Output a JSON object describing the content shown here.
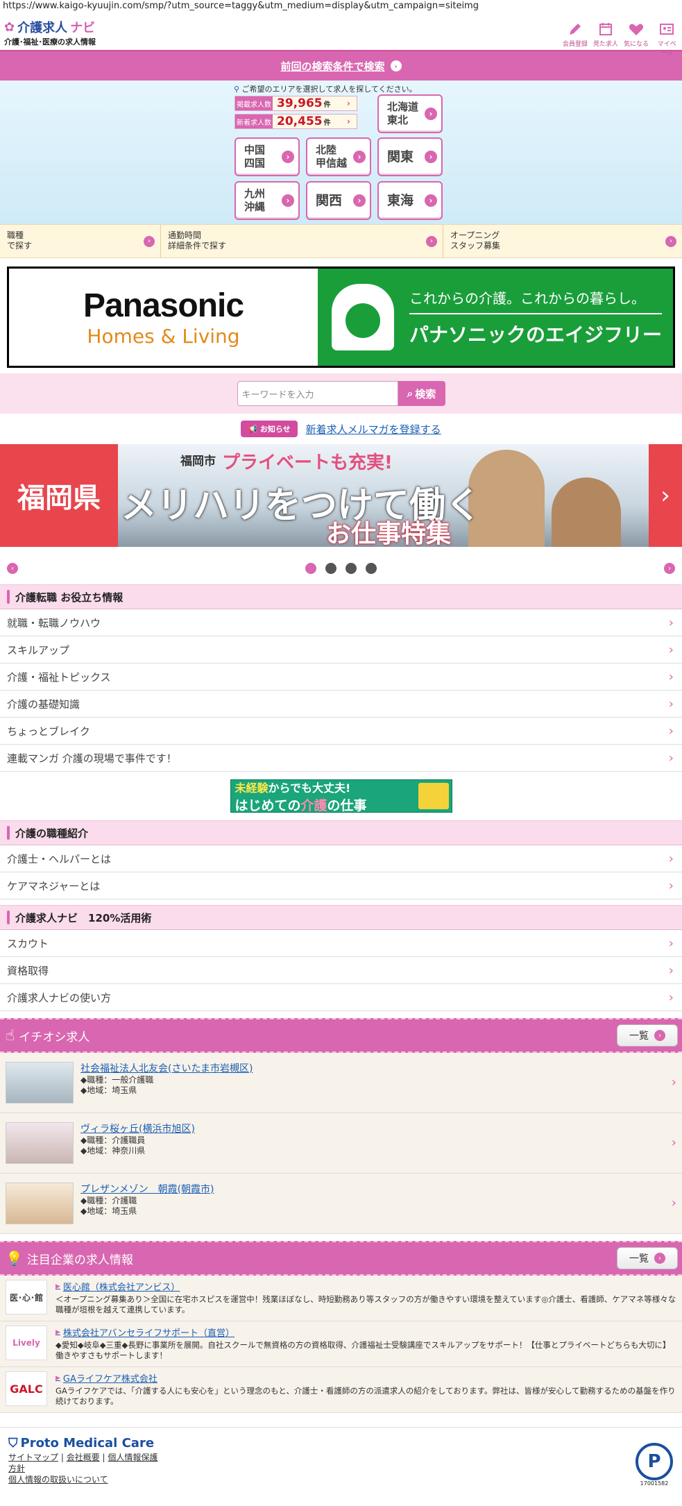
{
  "url": "https://www.kaigo-kyuujin.com/smp/?utm_source=taggy&utm_medium=display&utm_campaign=siteimg",
  "header": {
    "logo_name": "介護求人",
    "logo_navi": "ナビ",
    "logo_sub": "介護･福祉･医療の求人情報",
    "icons": [
      {
        "label": "会員登録",
        "icon": "pencil-icon"
      },
      {
        "label": "見た求人",
        "icon": "calendar-icon"
      },
      {
        "label": "気になる",
        "icon": "heart-icon"
      },
      {
        "label": "マイページ",
        "icon": "mypage-icon"
      }
    ]
  },
  "prev_search": "前回の検索条件で検索",
  "area": {
    "note": "ご希望のエリアを選択して求人を探してください。",
    "posted_label": "掲載求人数",
    "posted_count": "39,965",
    "new_label": "新着求人数",
    "new_count": "20,455",
    "unit": "件",
    "regions": {
      "hokkaido": [
        "北海道",
        "東北"
      ],
      "chugoku": [
        "中国",
        "四国"
      ],
      "hokuriku": [
        "北陸",
        "甲信越"
      ],
      "kanto": "関東",
      "kyushu": [
        "九州",
        "沖縄"
      ],
      "kansai": "関西",
      "tokai": "東海"
    }
  },
  "search_options": [
    [
      "職種",
      "で探す"
    ],
    [
      "通勤時間",
      "詳細条件で探す"
    ],
    [
      "オープニング",
      "スタッフ募集"
    ]
  ],
  "ad_banner": {
    "brand": "Panasonic",
    "brand_sub": "Homes & Living",
    "tagline": "これからの介護。これからの暮らし。",
    "name": "パナソニックのエイジフリー"
  },
  "keyword": {
    "placeholder": "キーワードを入力",
    "button": "検索"
  },
  "notice": {
    "badge": "お知らせ",
    "link": "新着求人メルマガを登録する"
  },
  "slide": {
    "pref": "福岡県",
    "city": "福岡市",
    "catch": "プライベートも充実!",
    "main": "メリハリをつけて働く",
    "sub": "お仕事特集"
  },
  "info_section": {
    "title": "介護転職 お役立ち情報",
    "items": [
      "就職・転職ノウハウ",
      "スキルアップ",
      "介護・福祉トピックス",
      "介護の基礎知識",
      "ちょっとブレイク",
      "連載マンガ 介護の現場で事件です！"
    ]
  },
  "mini_banner": {
    "line1_em": "未経験",
    "line1": "からでも大丈夫!",
    "line2a": "はじめての",
    "line2_em": "介護",
    "line2b": "の仕事"
  },
  "jobtype_section": {
    "title": "介護の職種紹介",
    "items": [
      "介護士・ヘルパーとは",
      "ケアマネジャーとは"
    ]
  },
  "usage_section": {
    "title": "介護求人ナビ　120%活用術",
    "items": [
      "スカウト",
      "資格取得",
      "介護求人ナビの使い方"
    ]
  },
  "featured": {
    "title": "イチオシ求人",
    "list_button": "一覧",
    "jobs": [
      {
        "name": "社会福祉法人北友会(さいたま市岩槻区)",
        "type": "◆職種：一般介護職",
        "area": "◆地域：埼玉県"
      },
      {
        "name": "ヴィラ桜ヶ丘(横浜市旭区)",
        "type": "◆職種：介護職員",
        "area": "◆地域：神奈川県"
      },
      {
        "name": "プレザンメゾン　朝霞(朝霞市)",
        "type": "◆職種：介護職",
        "area": "◆地域：埼玉県"
      }
    ]
  },
  "companies": {
    "title": "注目企業の求人情報",
    "list_button": "一覧",
    "items": [
      {
        "logo": "医･心･館",
        "name": "医心館（株式会社アンビス）",
        "desc": "＜オープニング募集あり＞全国に在宅ホスピスを運営中！残業ほぼなし、時短勤務あり等スタッフの方が働きやすい環境を整えています◎介護士、看護師、ケアマネ等様々な職種が垣根を越えて連携しています。"
      },
      {
        "logo": "Lively",
        "name": "株式会社アバンセライフサポート（直営）",
        "desc": "◆愛知◆岐阜◆三重◆長野に事業所を展開。自社スクールで無資格の方の資格取得、介護福祉士受験講座でスキルアップをサポート！【仕事とプライベートどちらも大切に】働きやすさもサポートします！"
      },
      {
        "logo": "GALC",
        "name": "GAライフケア株式会社",
        "desc": "GAライフケアでは、「介護する人にも安心を」という理念のもと、介護士・看護師の方の派遣求人の紹介をしております。弊社は、皆様が安心して勤務するための基盤を作り続けております。"
      }
    ]
  },
  "footer": {
    "brand": "Proto Medical Care",
    "links": [
      "サイトマップ",
      "会社概要",
      "個人情報保護"
    ],
    "link_extra": "方針",
    "link_last": "個人情報の取扱いについて",
    "privacy_mark_number": "17001582"
  }
}
